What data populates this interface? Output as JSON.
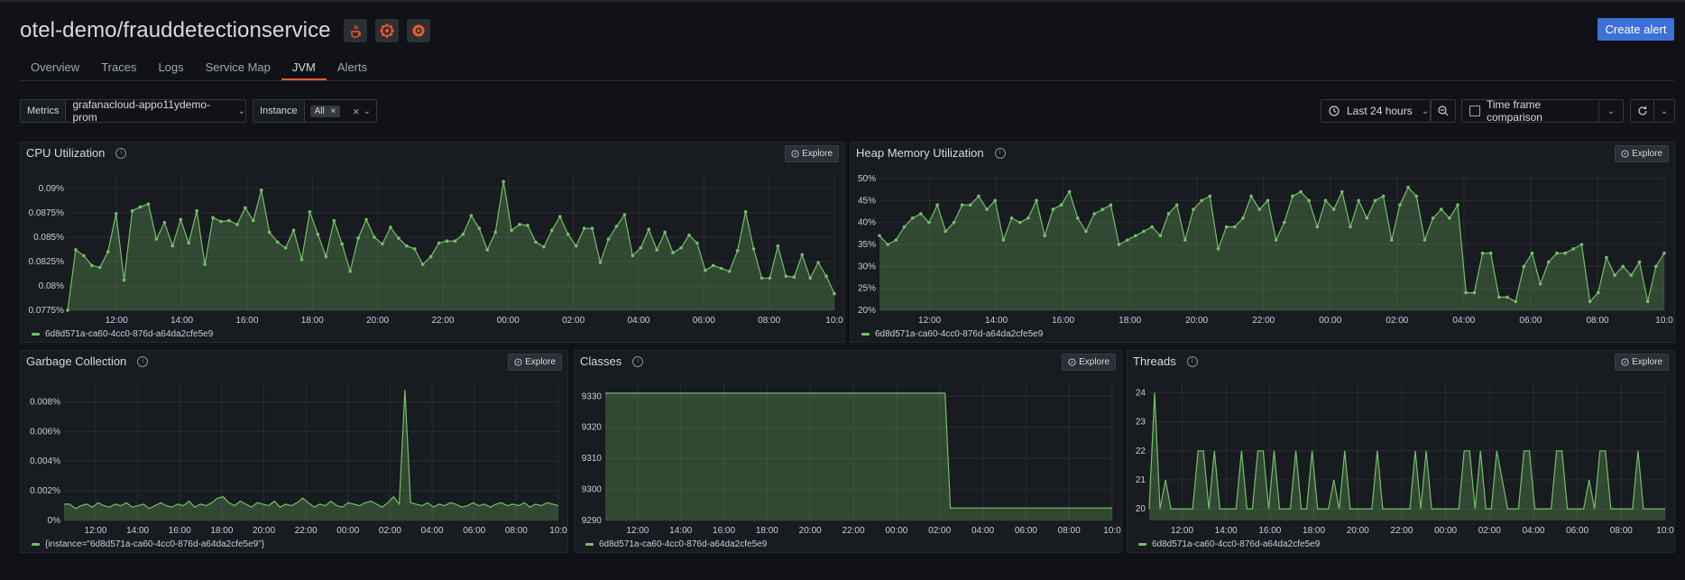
{
  "header": {
    "title": "otel-demo/frauddetectionservice",
    "icons": [
      "java-icon",
      "kubernetes-icon",
      "grafana-icon"
    ],
    "create_alert_label": "Create alert"
  },
  "tabs": [
    {
      "label": "Overview"
    },
    {
      "label": "Traces"
    },
    {
      "label": "Logs"
    },
    {
      "label": "Service Map"
    },
    {
      "label": "JVM",
      "active": true
    },
    {
      "label": "Alerts"
    }
  ],
  "controls": {
    "metrics_label": "Metrics",
    "metrics_value": "grafanacloud-appo11ydemo-prom",
    "instance_label": "Instance",
    "instance_value": "All",
    "time_range": "Last 24 hours",
    "time_comparison": "Time frame comparison"
  },
  "explore_label": "Explore",
  "accent_color": "#73bf69",
  "panels": {
    "cpu": {
      "title": "CPU Utilization",
      "legend": "6d8d571a-ca60-4cc0-876d-a64da2cfe5e9",
      "y_ticks": [
        "0.09%",
        "0.0875%",
        "0.085%",
        "0.0825%",
        "0.08%",
        "0.0775%"
      ],
      "x_ticks": [
        "12:00",
        "14:00",
        "16:00",
        "18:00",
        "20:00",
        "22:00",
        "00:00",
        "02:00",
        "04:00",
        "06:00",
        "08:00",
        "10:0"
      ]
    },
    "heap": {
      "title": "Heap Memory Utilization",
      "legend": "6d8d571a-ca60-4cc0-876d-a64da2cfe5e9",
      "y_ticks": [
        "50%",
        "45%",
        "40%",
        "35%",
        "30%",
        "25%",
        "20%"
      ],
      "x_ticks": [
        "12:00",
        "14:00",
        "16:00",
        "18:00",
        "20:00",
        "22:00",
        "00:00",
        "02:00",
        "04:00",
        "06:00",
        "08:00",
        "10:0"
      ]
    },
    "gc": {
      "title": "Garbage Collection",
      "legend": "{instance=\"6d8d571a-ca60-4cc0-876d-a64da2cfe5e9\"}",
      "y_ticks": [
        "0.008%",
        "0.006%",
        "0.004%",
        "0.002%",
        "0%"
      ],
      "x_ticks": [
        "12:00",
        "14:00",
        "16:00",
        "18:00",
        "20:00",
        "22:00",
        "00:00",
        "02:00",
        "04:00",
        "06:00",
        "08:00",
        "10:0"
      ]
    },
    "classes": {
      "title": "Classes",
      "legend": "6d8d571a-ca60-4cc0-876d-a64da2cfe5e9",
      "y_ticks": [
        "9330",
        "9320",
        "9310",
        "9300",
        "9290"
      ],
      "x_ticks": [
        "12:00",
        "14:00",
        "16:00",
        "18:00",
        "20:00",
        "22:00",
        "00:00",
        "02:00",
        "04:00",
        "06:00",
        "08:00",
        "10:0"
      ]
    },
    "threads": {
      "title": "Threads",
      "legend": "6d8d571a-ca60-4cc0-876d-a64da2cfe5e9",
      "y_ticks": [
        "24",
        "23",
        "22",
        "21",
        "20"
      ],
      "x_ticks": [
        "12:00",
        "14:00",
        "16:00",
        "18:00",
        "20:00",
        "22:00",
        "00:00",
        "02:00",
        "04:00",
        "06:00",
        "08:00",
        "10:0"
      ]
    }
  },
  "chart_data": [
    {
      "type": "area",
      "title": "CPU Utilization",
      "unit": "%",
      "ylim": [
        0.0775,
        0.091
      ],
      "series": [
        {
          "name": "6d8d571a-ca60-4cc0-876d-a64da2cfe5e9",
          "values": [
            0.0775,
            0.0837,
            0.0831,
            0.0821,
            0.0819,
            0.0835,
            0.0874,
            0.0806,
            0.0877,
            0.0881,
            0.0884,
            0.0848,
            0.0865,
            0.0841,
            0.0868,
            0.0844,
            0.0877,
            0.0822,
            0.087,
            0.0866,
            0.0867,
            0.0863,
            0.088,
            0.0867,
            0.0898,
            0.0855,
            0.0845,
            0.0839,
            0.0857,
            0.0827,
            0.0876,
            0.0853,
            0.083,
            0.0867,
            0.0843,
            0.0815,
            0.0849,
            0.0868,
            0.085,
            0.0843,
            0.086,
            0.0849,
            0.0841,
            0.0838,
            0.0822,
            0.083,
            0.0844,
            0.0846,
            0.0846,
            0.0853,
            0.0872,
            0.0859,
            0.0837,
            0.0855,
            0.0907,
            0.0857,
            0.0863,
            0.0862,
            0.0845,
            0.084,
            0.0857,
            0.0871,
            0.0853,
            0.0841,
            0.0859,
            0.0859,
            0.0824,
            0.0848,
            0.0861,
            0.0873,
            0.0831,
            0.0839,
            0.0858,
            0.0837,
            0.0855,
            0.0834,
            0.0839,
            0.0852,
            0.0844,
            0.0816,
            0.0821,
            0.0818,
            0.0815,
            0.0836,
            0.0876,
            0.0838,
            0.0808,
            0.0808,
            0.0841,
            0.081,
            0.0809,
            0.0832,
            0.0808,
            0.0824,
            0.081,
            0.0792
          ]
        }
      ]
    },
    {
      "type": "area",
      "title": "Heap Memory Utilization",
      "unit": "%",
      "ylim": [
        20,
        50
      ],
      "series": [
        {
          "name": "6d8d571a-ca60-4cc0-876d-a64da2cfe5e9",
          "values": [
            37,
            35,
            36,
            39,
            41,
            42,
            40,
            44,
            38,
            40,
            44,
            44,
            46,
            43,
            45,
            36,
            41,
            40,
            41,
            45,
            37,
            43,
            44,
            47,
            41,
            38,
            42,
            43,
            44,
            35,
            36,
            37,
            38,
            39,
            37,
            42,
            44,
            36,
            43,
            45,
            46,
            34,
            39,
            39,
            41,
            46,
            43,
            45,
            36,
            40,
            46,
            47,
            45,
            39,
            45,
            43,
            47,
            39,
            45,
            41,
            45,
            46,
            36,
            44,
            48,
            46,
            36,
            41,
            43,
            41,
            44,
            24,
            24,
            33,
            33,
            23,
            23,
            22,
            30,
            33,
            26,
            31,
            33,
            33,
            34,
            35,
            22,
            24,
            32,
            28,
            30,
            28,
            31,
            22,
            30,
            33
          ]
        }
      ]
    },
    {
      "type": "area",
      "title": "Garbage Collection",
      "unit": "%",
      "ylim": [
        0,
        0.009
      ],
      "series": [
        {
          "name": "{instance=\"6d8d571a-ca60-4cc0-876d-a64da2cfe5e9\"}",
          "values": [
            0.0011,
            0.0011,
            0.0008,
            0.001,
            0.0011,
            0.0009,
            0.0012,
            0.001,
            0.0009,
            0.0011,
            0.001,
            0.0012,
            0.0009,
            0.001,
            0.0011,
            0.0008,
            0.001,
            0.0012,
            0.001,
            0.0009,
            0.0011,
            0.001,
            0.0013,
            0.0009,
            0.0011,
            0.001,
            0.0012,
            0.0015,
            0.0016,
            0.0012,
            0.001,
            0.0013,
            0.0011,
            0.0009,
            0.0012,
            0.0011,
            0.001,
            0.0013,
            0.0009,
            0.0011,
            0.001,
            0.0012,
            0.0015,
            0.0012,
            0.0009,
            0.0011,
            0.001,
            0.0013,
            0.001,
            0.0009,
            0.0012,
            0.0011,
            0.001,
            0.0012,
            0.0013,
            0.0011,
            0.0009,
            0.0012,
            0.0016,
            0.0011,
            0.0088,
            0.0012,
            0.0011,
            0.001,
            0.0012,
            0.0009,
            0.0011,
            0.001,
            0.0012,
            0.0011,
            0.0009,
            0.001,
            0.0012,
            0.001,
            0.0011,
            0.0009,
            0.0011,
            0.0012,
            0.001,
            0.0011,
            0.001,
            0.0012,
            0.0009,
            0.0011,
            0.001,
            0.0012,
            0.0011,
            0.001
          ]
        }
      ]
    },
    {
      "type": "area",
      "title": "Classes",
      "ylim": [
        9290,
        9333
      ],
      "series": [
        {
          "name": "6d8d571a-ca60-4cc0-876d-a64da2cfe5e9",
          "values": [
            9331,
            9331,
            9331,
            9331,
            9331,
            9331,
            9331,
            9331,
            9331,
            9331,
            9331,
            9331,
            9331,
            9331,
            9331,
            9331,
            9331,
            9331,
            9331,
            9331,
            9331,
            9331,
            9331,
            9331,
            9331,
            9331,
            9331,
            9331,
            9331,
            9331,
            9331,
            9331,
            9331,
            9331,
            9331,
            9331,
            9331,
            9331,
            9331,
            9331,
            9331,
            9331,
            9331,
            9331,
            9331,
            9331,
            9331,
            9331,
            9331,
            9331,
            9331,
            9331,
            9331,
            9331,
            9331,
            9331,
            9331,
            9331,
            9331,
            9331,
            9331,
            9331,
            9331,
            9331,
            9294,
            9294,
            9294,
            9294,
            9294,
            9294,
            9294,
            9294,
            9294,
            9294,
            9294,
            9294,
            9294,
            9294,
            9294,
            9294,
            9294,
            9294,
            9294,
            9294,
            9294,
            9294,
            9294,
            9294,
            9294,
            9294,
            9294,
            9294,
            9294,
            9294,
            9294
          ]
        }
      ]
    },
    {
      "type": "area",
      "title": "Threads",
      "ylim": [
        19.6,
        24.2
      ],
      "series": [
        {
          "name": "6d8d571a-ca60-4cc0-876d-a64da2cfe5e9",
          "values": [
            20,
            24,
            20,
            21,
            20,
            20,
            20,
            20,
            20,
            22,
            22,
            20,
            22,
            20,
            20,
            20,
            20,
            22,
            20,
            20,
            22,
            22,
            20,
            22,
            20,
            20,
            20,
            22,
            20,
            20,
            22,
            20,
            20,
            20,
            21,
            20,
            22,
            20,
            20,
            20,
            20,
            20,
            22,
            20,
            20,
            20,
            20,
            20,
            20,
            22,
            20,
            22,
            20,
            20,
            20,
            20,
            20,
            20,
            22,
            22,
            20,
            22,
            20,
            20,
            22,
            21,
            20,
            20,
            20,
            22,
            22,
            20,
            20,
            20,
            20,
            22,
            22,
            20,
            20,
            20,
            20,
            21,
            20,
            22,
            22,
            20,
            20,
            20,
            20,
            20,
            22,
            20,
            20,
            20,
            20,
            20
          ]
        }
      ]
    }
  ]
}
